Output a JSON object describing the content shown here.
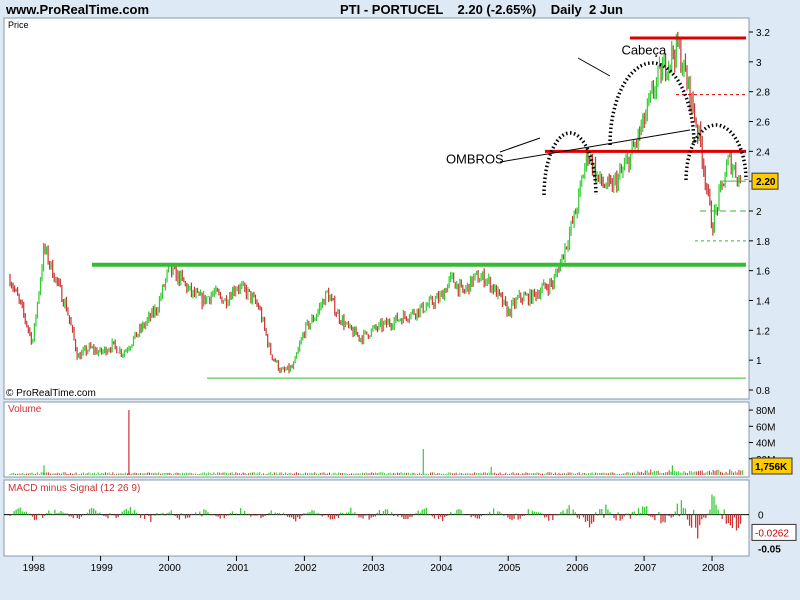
{
  "header": {
    "site": "www.ProRealTime.com",
    "symbol": "PTI - PORTUCEL",
    "last": "2.20 (-2.65%)",
    "period": "Daily",
    "date": "2 Jun"
  },
  "panels": {
    "price_title": "Price",
    "volume_title": "Volume",
    "macd_title": "MACD minus Signal (12 26 9)",
    "copyright": "© ProRealTime.com"
  },
  "colors": {
    "up": "#33cc33",
    "down": "#cc3333",
    "support": "#33bb33",
    "resistance": "#dd0000",
    "background": "#ffffff",
    "frame": "#dde9f4",
    "last_badge": "#ffcc00"
  },
  "chart_data": [
    {
      "type": "line",
      "title": "PTI - PORTUCEL",
      "x_range": [
        "1997-09",
        "2008-07"
      ],
      "ylim": [
        0.8,
        3.2
      ],
      "yticks": [
        "0.8",
        "1",
        "1.2",
        "1.4",
        "1.6",
        "1.8",
        "2",
        "2.2",
        "2.4",
        "2.6",
        "2.8",
        "3",
        "3.2"
      ],
      "xticks": [
        "1998",
        "1999",
        "2000",
        "2001",
        "2002",
        "2003",
        "2004",
        "2005",
        "2006",
        "2007",
        "2008"
      ],
      "last_value": "2.20",
      "series": [
        {
          "values": [
            [
              "1997-09",
              1.55
            ],
            [
              "1997-11",
              1.35
            ],
            [
              "1998-01",
              1.12
            ],
            [
              "1998-03",
              1.75
            ],
            [
              "1998-05",
              1.55
            ],
            [
              "1998-07",
              1.35
            ],
            [
              "1998-09",
              1.02
            ],
            [
              "1998-11",
              1.08
            ],
            [
              "1999-01",
              1.05
            ],
            [
              "1999-03",
              1.1
            ],
            [
              "1999-05",
              1.05
            ],
            [
              "1999-07",
              1.15
            ],
            [
              "1999-09",
              1.25
            ],
            [
              "1999-11",
              1.35
            ],
            [
              "2000-01",
              1.6
            ],
            [
              "2000-03",
              1.55
            ],
            [
              "2000-05",
              1.45
            ],
            [
              "2000-07",
              1.4
            ],
            [
              "2000-09",
              1.45
            ],
            [
              "2000-11",
              1.4
            ],
            [
              "2001-01",
              1.5
            ],
            [
              "2001-03",
              1.45
            ],
            [
              "2001-05",
              1.35
            ],
            [
              "2001-07",
              1.05
            ],
            [
              "2001-09",
              0.92
            ],
            [
              "2001-11",
              0.95
            ],
            [
              "2002-01",
              1.2
            ],
            [
              "2002-03",
              1.3
            ],
            [
              "2002-05",
              1.45
            ],
            [
              "2002-07",
              1.3
            ],
            [
              "2002-09",
              1.2
            ],
            [
              "2002-11",
              1.15
            ],
            [
              "2003-01",
              1.2
            ],
            [
              "2003-04",
              1.25
            ],
            [
              "2003-07",
              1.3
            ],
            [
              "2003-10",
              1.35
            ],
            [
              "2004-01",
              1.42
            ],
            [
              "2004-03",
              1.55
            ],
            [
              "2004-05",
              1.45
            ],
            [
              "2004-07",
              1.55
            ],
            [
              "2004-09",
              1.55
            ],
            [
              "2004-11",
              1.45
            ],
            [
              "2005-01",
              1.32
            ],
            [
              "2005-03",
              1.42
            ],
            [
              "2005-05",
              1.42
            ],
            [
              "2005-07",
              1.48
            ],
            [
              "2005-09",
              1.52
            ],
            [
              "2005-11",
              1.75
            ],
            [
              "2006-01",
              2.0
            ],
            [
              "2006-03",
              2.4
            ],
            [
              "2006-05",
              2.2
            ],
            [
              "2006-07",
              2.15
            ],
            [
              "2006-09",
              2.25
            ],
            [
              "2006-11",
              2.4
            ],
            [
              "2007-01",
              2.6
            ],
            [
              "2007-03",
              2.85
            ],
            [
              "2007-05",
              3.0
            ],
            [
              "2007-07",
              3.1
            ],
            [
              "2007-09",
              2.8
            ],
            [
              "2007-11",
              2.45
            ],
            [
              "2008-01",
              1.9
            ],
            [
              "2008-02",
              2.05
            ],
            [
              "2008-04",
              2.35
            ],
            [
              "2008-06",
              2.2
            ]
          ]
        }
      ],
      "levels": [
        {
          "y": 1.64,
          "style": "support"
        },
        {
          "y": 2.4,
          "style": "resistance"
        },
        {
          "y": 3.16,
          "style": "resistance"
        }
      ],
      "annotations": [
        {
          "text": "Cabeça",
          "x": "2006-09",
          "y": 3.05
        },
        {
          "text": "OMBROS",
          "x": "2004-02",
          "y": 2.32
        }
      ]
    },
    {
      "type": "bar",
      "title": "Volume",
      "ylim": [
        0,
        85
      ],
      "yticks": [
        "20M",
        "40M",
        "60M",
        "80M"
      ],
      "last_value": "1,756K",
      "spikes": [
        [
          "1998-03",
          12
        ],
        [
          "1999-06",
          80
        ],
        [
          "2003-10",
          32
        ],
        [
          "2004-10",
          10
        ],
        [
          "2007-06",
          12
        ]
      ]
    },
    {
      "type": "bar",
      "title": "MACD minus Signal (12 26 9)",
      "ylim": [
        -0.055,
        0.045
      ],
      "yticks": [
        "0",
        "-0.05"
      ],
      "last_value": "-0.0262"
    }
  ]
}
